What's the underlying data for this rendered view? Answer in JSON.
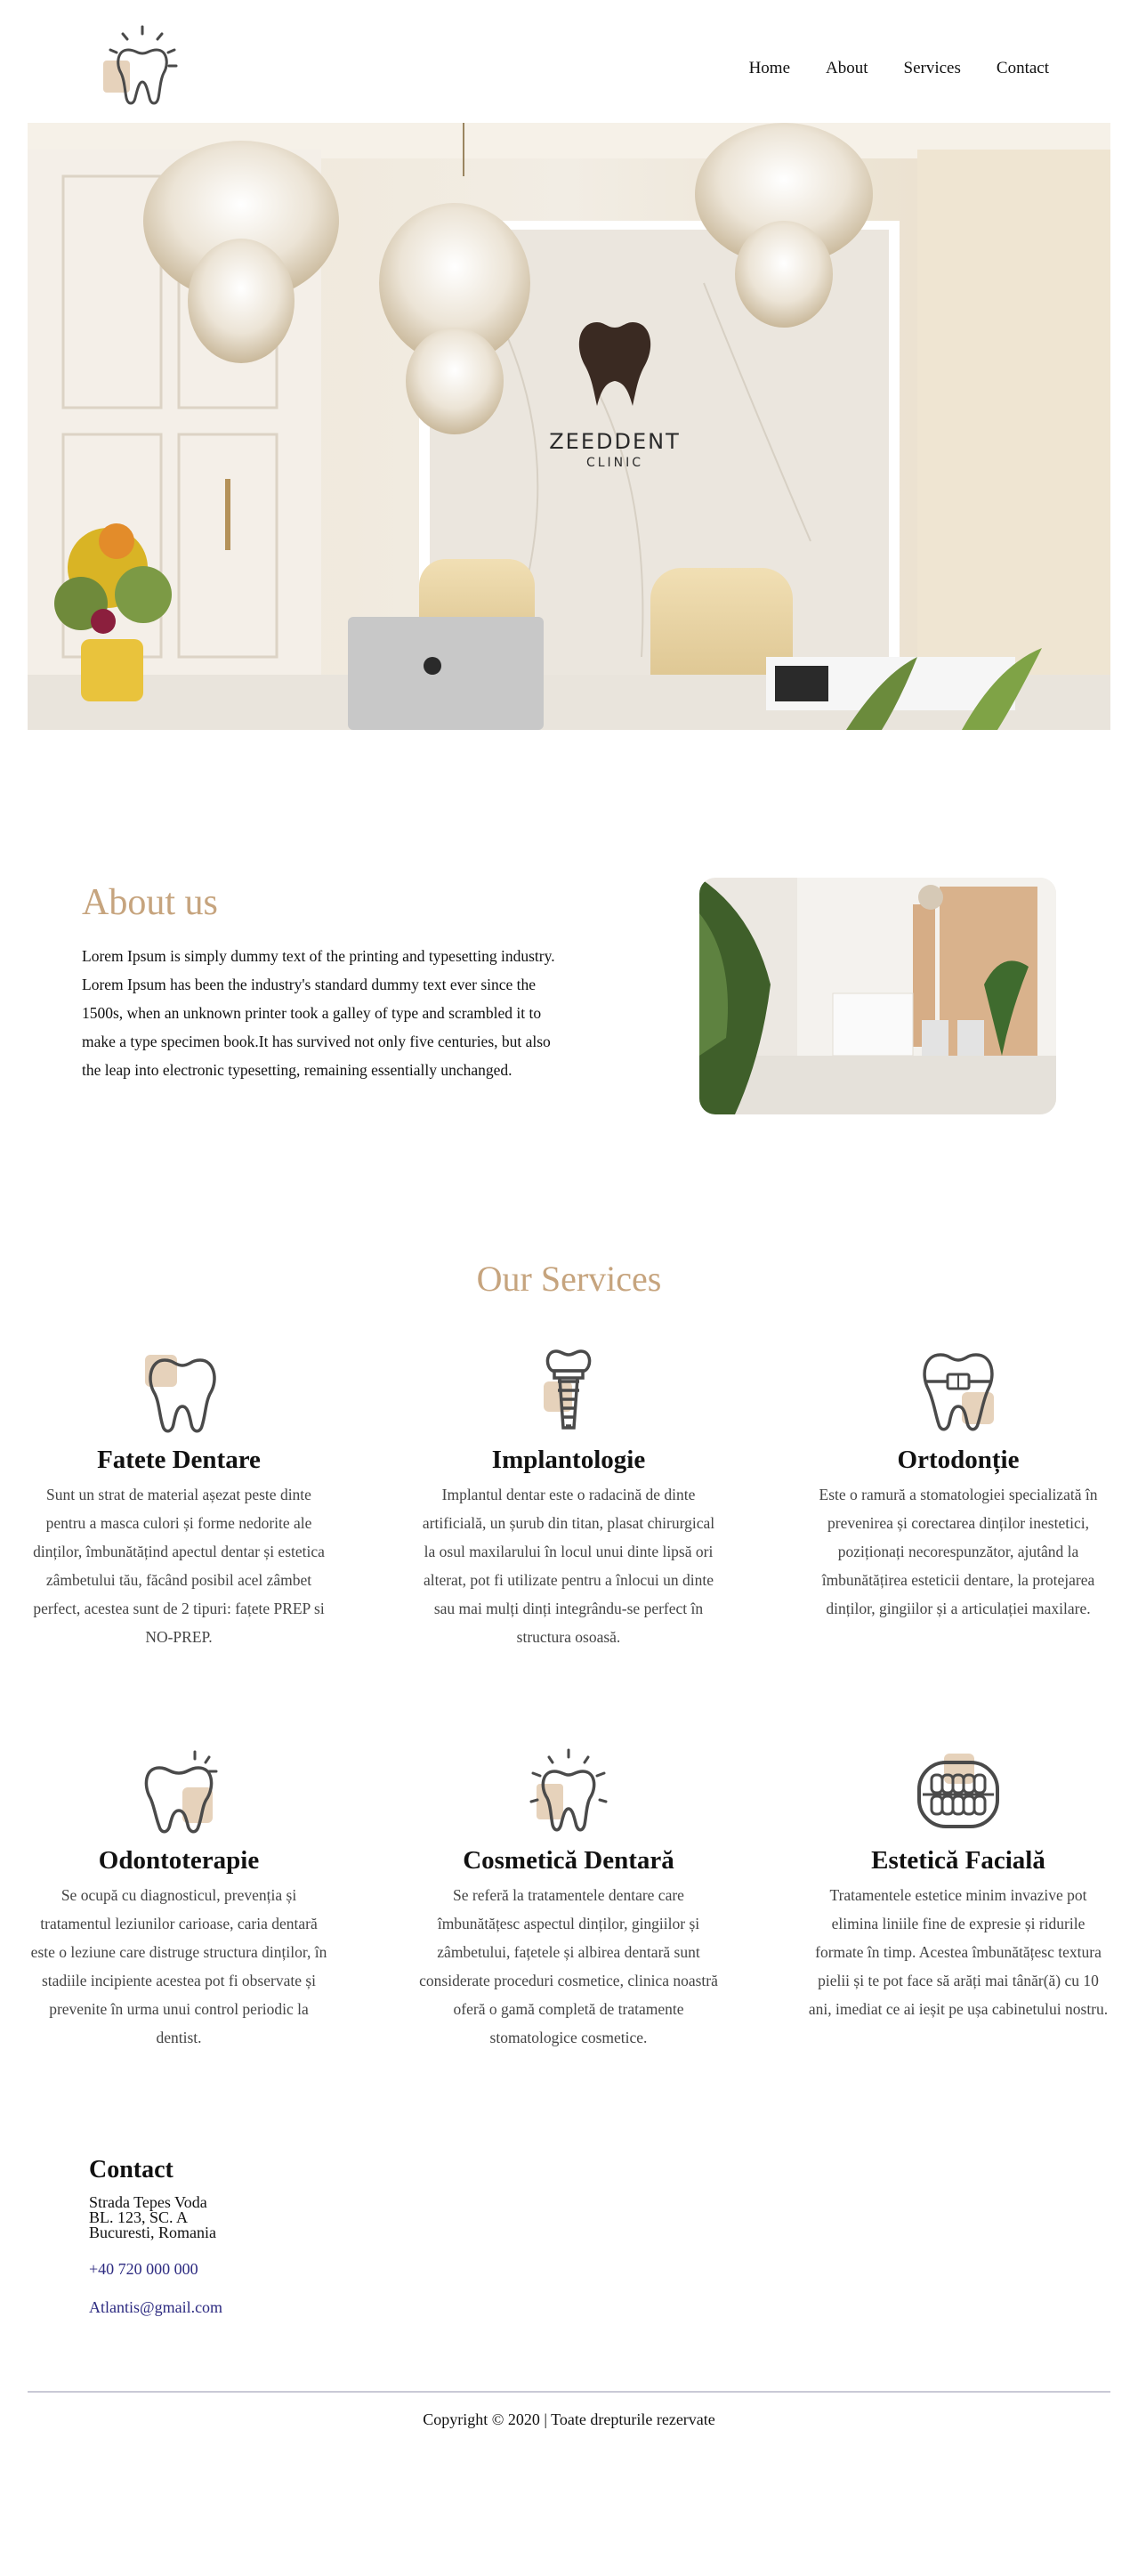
{
  "nav": {
    "items": [
      {
        "label": "Home"
      },
      {
        "label": "About"
      },
      {
        "label": "Services"
      },
      {
        "label": "Contact"
      }
    ]
  },
  "hero": {
    "brand_name": "ZEEDDENT",
    "brand_sub": "CLINIC"
  },
  "about": {
    "title": "About us",
    "text": "Lorem Ipsum is simply dummy text of the printing and typesetting industry. Lorem Ipsum has been the industry's standard dummy text ever since the 1500s, when an unknown printer took a galley of type and scrambled it to make a type specimen book.It has survived not only five centuries, but also the leap into electronic typesetting, remaining essentially unchanged."
  },
  "services": {
    "title": "Our Services",
    "items": [
      {
        "icon": "tooth-icon",
        "name": "Fatete Dentare",
        "text": "Sunt un strat de material așezat peste dinte pentru a masca culori și forme nedorite ale dinților, îmbunătățind apectul dentar și estetica zâmbetului tău, făcând posibil acel zâmbet perfect, acestea sunt de 2 tipuri: fațete PREP si NO-PREP."
      },
      {
        "icon": "dental-implant-icon",
        "name": "Implantologie",
        "text": "Implantul dentar este o radacină de dinte artificială, un șurub din titan, plasat chirurgical la osul maxilarului în locul unui dinte lipsă ori alterat, pot fi utilizate pentru a înlocui un dinte sau mai mulți dinți integrându-se perfect în structura osoasă."
      },
      {
        "icon": "tooth-braces-icon",
        "name": "Ortodonție",
        "text": "Este o ramură a stomatologiei specializată în prevenirea și corectarea dinților inestetici, poziționați necorespunzător, ajutând la îmbunătățirea esteticii dentare, la protejarea dinților, gingiilor și a articulației maxilare."
      },
      {
        "icon": "tooth-sparkle-icon",
        "name": "Odontoterapie",
        "text": "Se ocupă cu diagnosticul, prevenția și tratamentul leziunilor carioase, caria dentară este o leziune care distruge structura dinților, în stadiile incipiente acestea pot fi observate și prevenite în urma unui control periodic la dentist."
      },
      {
        "icon": "shining-tooth-icon",
        "name": "Cosmetică Dentară",
        "text": "Se referă la tratamentele dentare care îmbunătățesc aspectul dinților, gingiilor și zâmbetului, fațetele și albirea dentară sunt considerate proceduri cosmetice, clinica noastră oferă o gamă completă de tratamente stomatologice cosmetice."
      },
      {
        "icon": "teeth-smile-icon",
        "name": "Estetică Facială",
        "text": "Tratamentele estetice minim invazive pot elimina liniile fine de expresie și ridurile formate în timp. Acestea îmbunătățesc textura pielii și te pot face să arăți mai tânăr(ă) cu 10 ani, imediat ce ai ieșit pe ușa cabinetului nostru."
      }
    ]
  },
  "contact": {
    "title": "Contact",
    "address_line1": "Strada Tepes Voda",
    "address_line2": "BL. 123, SC. A",
    "address_line3": "Bucuresti, Romania",
    "phone": "+40 720 000 000",
    "email": "Atlantis@gmail.com"
  },
  "footer": {
    "copyright": "Copyright © 2020 | Toate drepturile rezervate"
  },
  "colors": {
    "accent": "#c6a47e",
    "icon_fill": "#e6d2bb",
    "icon_stroke": "#4a4a4a",
    "link": "#2c2a80"
  }
}
